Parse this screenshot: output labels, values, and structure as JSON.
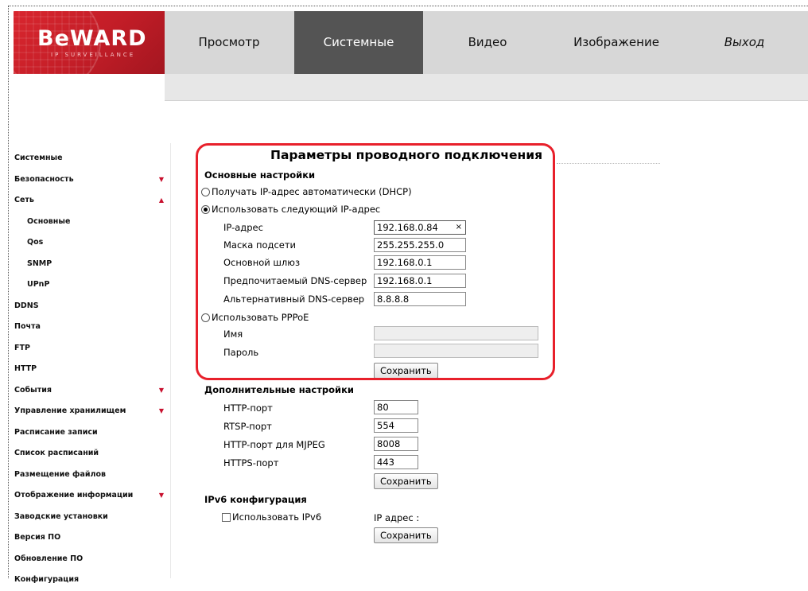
{
  "logo": {
    "text": "BeWARD",
    "sub": "IP SURVEILLANCE"
  },
  "nav": {
    "view": "Просмотр",
    "system": "Системные",
    "video": "Видео",
    "image": "Изображение",
    "exit": "Выход"
  },
  "sidebar": {
    "items": [
      {
        "label": "Системные"
      },
      {
        "label": "Безопасность",
        "arrow": "▼"
      },
      {
        "label": "Сеть",
        "arrow": "▲"
      },
      {
        "label": "Основные"
      },
      {
        "label": "Qos"
      },
      {
        "label": "SNMP"
      },
      {
        "label": "UPnP"
      },
      {
        "label": "DDNS"
      },
      {
        "label": "Почта"
      },
      {
        "label": "FTP"
      },
      {
        "label": "HTTP"
      },
      {
        "label": "События",
        "arrow": "▼"
      },
      {
        "label": "Управление хранилищем",
        "arrow": "▼"
      },
      {
        "label": "Расписание записи"
      },
      {
        "label": "Список расписаний"
      },
      {
        "label": "Размещение файлов"
      },
      {
        "label": "Отображение информации",
        "arrow": "▼"
      },
      {
        "label": "Заводские установки"
      },
      {
        "label": "Версия ПО"
      },
      {
        "label": "Обновление ПО"
      },
      {
        "label": "Конфигурация"
      }
    ]
  },
  "main": {
    "title": "Параметры проводного подключения",
    "basic": {
      "heading": "Основные настройки",
      "dhcp_label": "Получать IP-адрес автоматически (DHCP)",
      "static_label": "Использовать следующий IP-адрес",
      "ip_label": "IP-адрес",
      "ip_value": "192.168.0.84",
      "mask_label": "Маска подсети",
      "mask_value": "255.255.255.0",
      "gateway_label": "Основной шлюз",
      "gateway_value": "192.168.0.1",
      "dns1_label": "Предпочитаемый DNS-сервер",
      "dns1_value": "192.168.0.1",
      "dns2_label": "Альтернативный DNS-сервер",
      "dns2_value": "8.8.8.8",
      "pppoe_label": "Использовать PPPoE",
      "name_label": "Имя",
      "password_label": "Пароль",
      "save": "Сохранить"
    },
    "advanced": {
      "heading": "Дополнительные настройки",
      "http_label": "HTTP-порт",
      "http_value": "80",
      "rtsp_label": "RTSP-порт",
      "rtsp_value": "554",
      "mjpeg_label": "HTTP-порт для MJPEG",
      "mjpeg_value": "8008",
      "https_label": "HTTPS-порт",
      "https_value": "443",
      "save": "Сохранить"
    },
    "ipv6": {
      "heading": "IPv6 конфигурация",
      "use_label": "Использовать IPv6",
      "ip_label": "IP адрес :",
      "save": "Сохранить"
    }
  }
}
